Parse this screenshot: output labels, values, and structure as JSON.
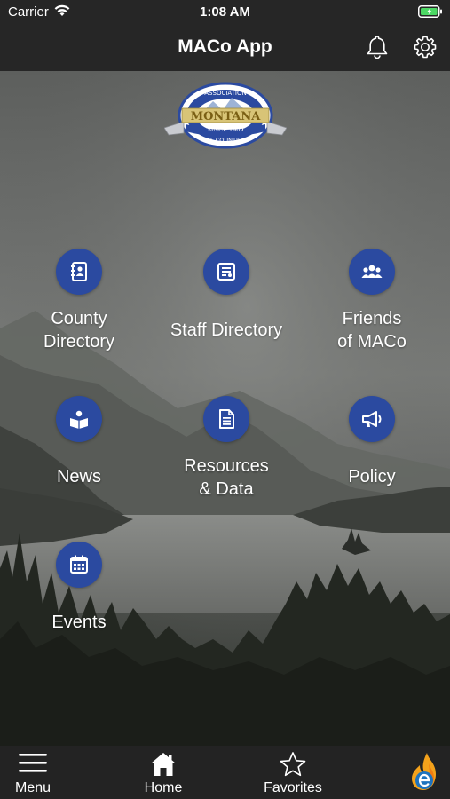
{
  "status_bar": {
    "carrier": "Carrier",
    "time": "1:08 AM"
  },
  "header": {
    "title": "MACo App",
    "bell_icon": "bell-icon",
    "settings_icon": "gear-icon"
  },
  "logo": {
    "top_text": "ASSOCIATION",
    "state_text": "MONTANA",
    "since_text": "SINCE 1909",
    "bottom_text": "OF COUNTIES"
  },
  "grid": [
    {
      "label_line1": "County",
      "label_line2": "Directory",
      "icon": "contacts-book-icon"
    },
    {
      "label_line1": "Staff Directory",
      "label_line2": "",
      "icon": "staff-card-icon"
    },
    {
      "label_line1": "Friends",
      "label_line2": "of MACo",
      "icon": "group-icon"
    },
    {
      "label_line1": "News",
      "label_line2": "",
      "icon": "news-reader-icon"
    },
    {
      "label_line1": "Resources",
      "label_line2": "& Data",
      "icon": "document-icon"
    },
    {
      "label_line1": "Policy",
      "label_line2": "",
      "icon": "megaphone-icon"
    },
    {
      "label_line1": "Events",
      "label_line2": "",
      "icon": "calendar-icon"
    }
  ],
  "tab_bar": {
    "menu": "Menu",
    "home": "Home",
    "favorites": "Favorites",
    "brand_icon": "flame-e-logo-icon"
  },
  "colors": {
    "bar_bg": "#262626",
    "icon_circle": "#2b4aa0",
    "text": "#ffffff"
  }
}
